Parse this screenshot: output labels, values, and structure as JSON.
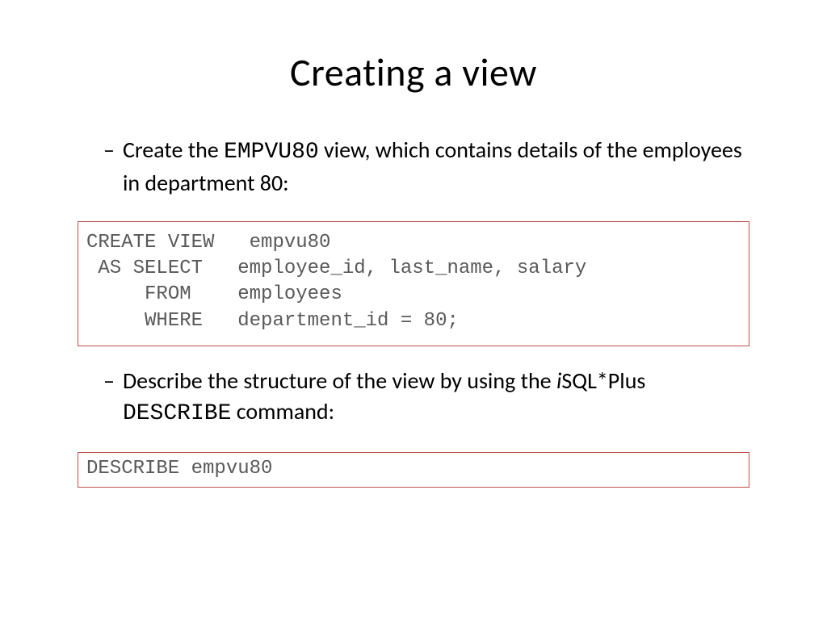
{
  "title": "Creating a view",
  "bullets": {
    "b1_pre": "Create the ",
    "b1_mono": "EMPVU80",
    "b1_post": " view, which contains details of the employees in department 80:",
    "b2_pre": "Describe the structure of the view by using the ",
    "b2_i": "i",
    "b2_mid": "SQL*Plus ",
    "b2_mono": "DESCRIBE",
    "b2_post": " command:"
  },
  "code1": "CREATE VIEW   empvu80\n AS SELECT   employee_id, last_name, salary\n     FROM    employees\n     WHERE   department_id = 80;",
  "code2": "DESCRIBE empvu80"
}
